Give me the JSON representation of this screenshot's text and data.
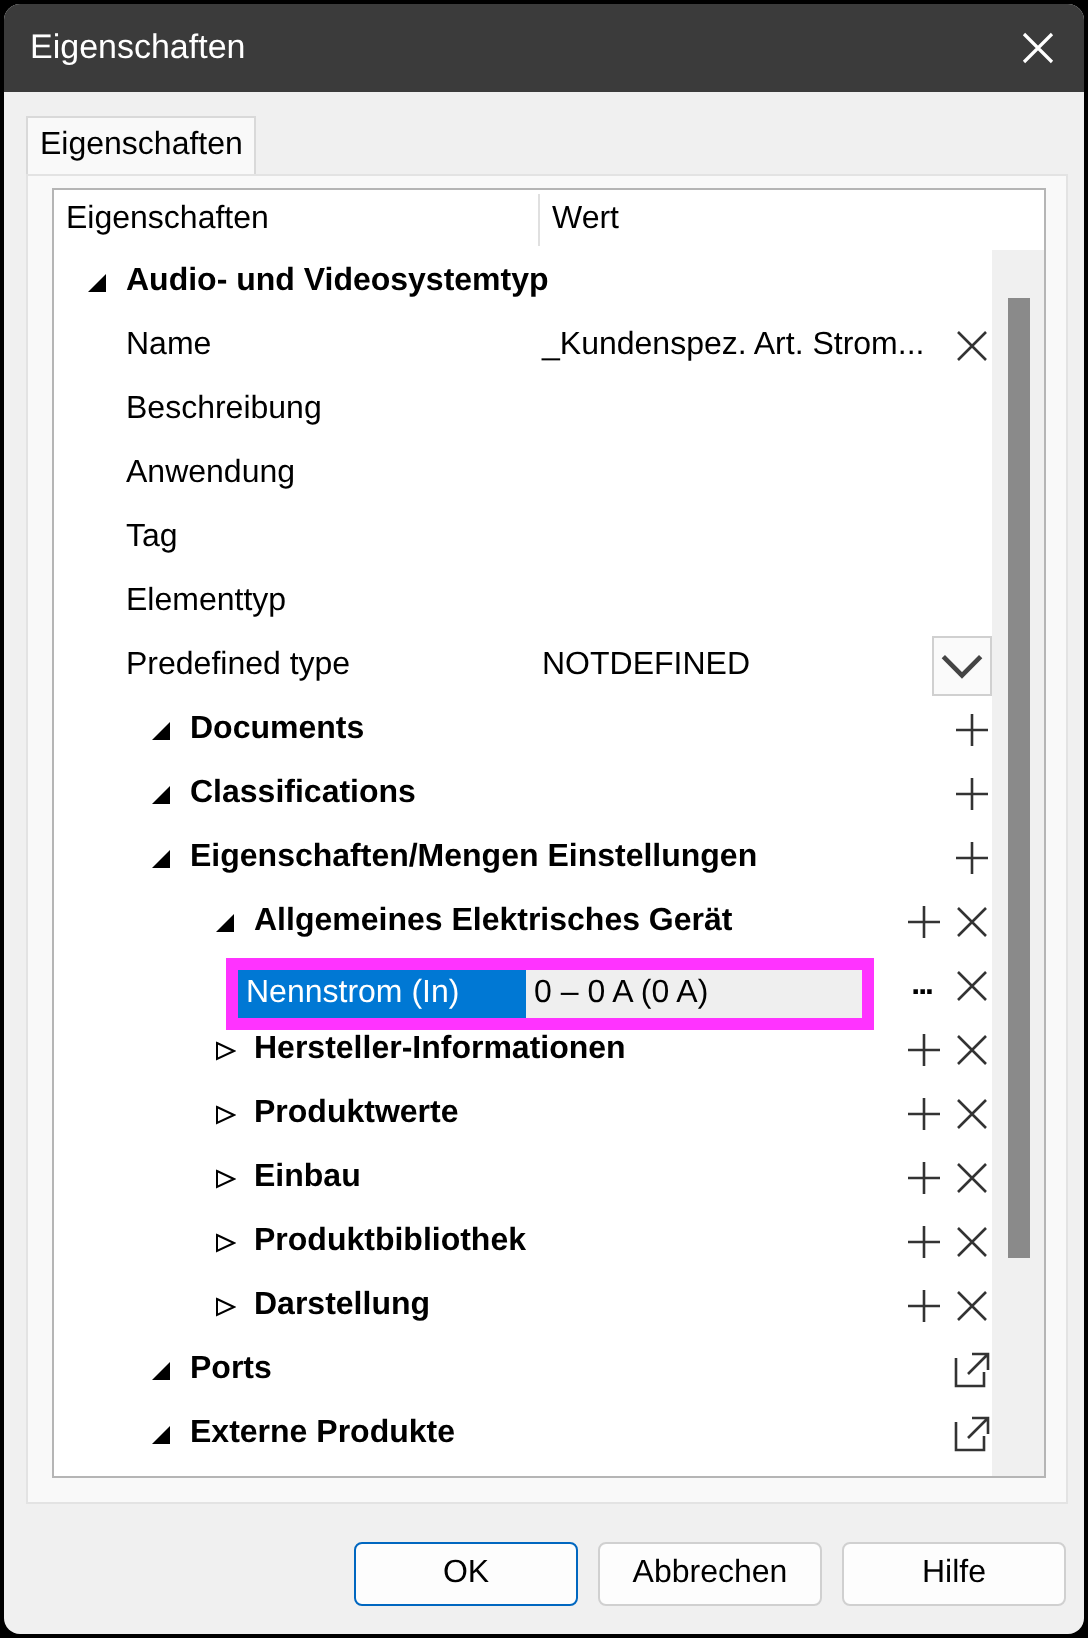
{
  "window": {
    "title": "Eigenschaften"
  },
  "tabs": [
    {
      "label": "Eigenschaften",
      "selected": true
    }
  ],
  "columns": [
    "Eigenschaften",
    "Wert"
  ],
  "tree": [
    {
      "kind": "group",
      "label": "Audio- und Videosystemtyp",
      "expanded": true,
      "children": [
        {
          "kind": "property",
          "label": "Name",
          "value": "_Kundenspez. Art. Strom...",
          "can_remove": true
        },
        {
          "kind": "property",
          "label": "Beschreibung"
        },
        {
          "kind": "property",
          "label": "Anwendung"
        },
        {
          "kind": "property",
          "label": "Tag"
        },
        {
          "kind": "property",
          "label": "Elementtyp"
        },
        {
          "kind": "property",
          "label": "Predefined type",
          "value": "NOTDEFINED",
          "dropdown": true
        },
        {
          "kind": "group",
          "label": "Documents",
          "expanded": true,
          "can_add": true
        },
        {
          "kind": "group",
          "label": "Classifications",
          "expanded": true,
          "can_add": true
        },
        {
          "kind": "group",
          "label": "Eigenschaften/Mengen Einstellungen",
          "expanded": true,
          "can_add": true,
          "children": [
            {
              "kind": "group",
              "label": "Allgemeines Elektrisches Gerät",
              "expanded": true,
              "can_add": true,
              "can_remove": true,
              "children": [
                {
                  "kind": "property",
                  "label": "Nennstrom (In)",
                  "value": "0 – 0 A (0 A)",
                  "selected": true,
                  "browse": "...",
                  "can_remove": true
                }
              ]
            },
            {
              "kind": "group",
              "label": "Hersteller-Informationen",
              "expanded": false,
              "can_add": true,
              "can_remove": true
            },
            {
              "kind": "group",
              "label": "Produktwerte",
              "expanded": false,
              "can_add": true,
              "can_remove": true
            },
            {
              "kind": "group",
              "label": "Einbau",
              "expanded": false,
              "can_add": true,
              "can_remove": true
            },
            {
              "kind": "group",
              "label": "Produktbibliothek",
              "expanded": false,
              "can_add": true,
              "can_remove": true
            },
            {
              "kind": "group",
              "label": "Darstellung",
              "expanded": false,
              "can_add": true,
              "can_remove": true
            }
          ]
        },
        {
          "kind": "group",
          "label": "Ports",
          "expanded": true,
          "can_open": true
        },
        {
          "kind": "group",
          "label": "Externe Produkte",
          "expanded": true,
          "can_open": true
        }
      ]
    }
  ],
  "buttons": [
    {
      "label": "OK",
      "default": true
    },
    {
      "label": "Abbrechen",
      "default": false
    },
    {
      "label": "Hilfe",
      "default": false
    }
  ]
}
